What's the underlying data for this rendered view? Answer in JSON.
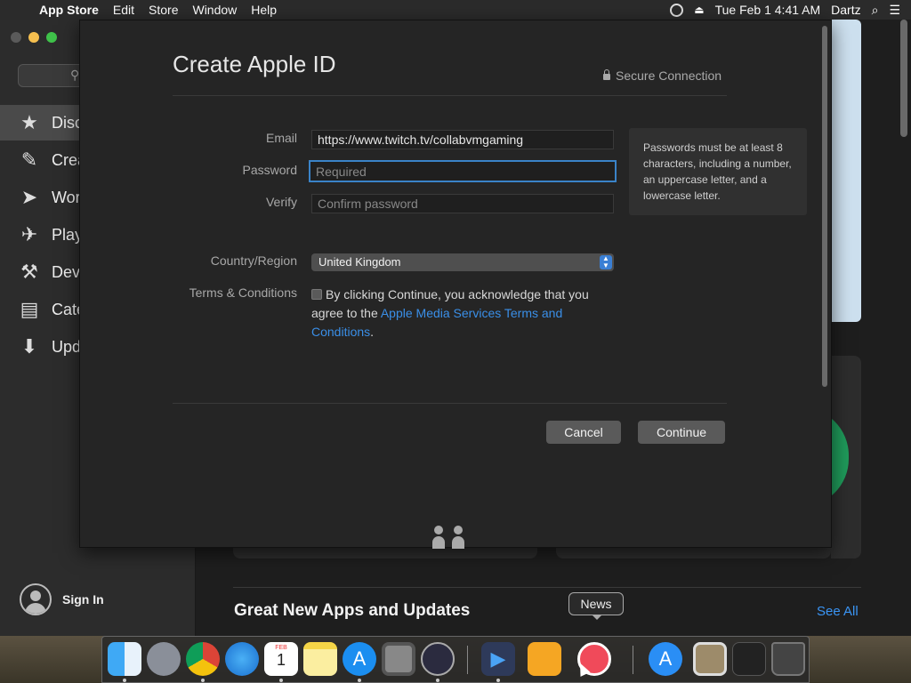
{
  "menubar": {
    "app_name": "App Store",
    "items": [
      "Edit",
      "Store",
      "Window",
      "Help"
    ],
    "clock": "Tue Feb 1  4:41 AM",
    "user": "Dartz"
  },
  "sidebar": {
    "items": [
      {
        "label": "Disc",
        "icon": "star-icon"
      },
      {
        "label": "Crea",
        "icon": "brush-icon"
      },
      {
        "label": "Wor",
        "icon": "paper-plane-icon"
      },
      {
        "label": "Play",
        "icon": "rocket-icon"
      },
      {
        "label": "Dev",
        "icon": "hammer-icon"
      },
      {
        "label": "Cate",
        "icon": "stack-icon"
      },
      {
        "label": "Upd",
        "icon": "download-icon"
      }
    ],
    "sign_in": "Sign In"
  },
  "main": {
    "section_title": "Great New Apps and Updates",
    "see_all": "See All"
  },
  "sheet": {
    "title": "Create Apple ID",
    "secure": "Secure Connection",
    "email_label": "Email",
    "email_value": "https://www.twitch.tv/collabvmgaming",
    "password_label": "Password",
    "password_placeholder": "Required",
    "verify_label": "Verify",
    "verify_placeholder": "Confirm password",
    "password_hint": "Passwords must be at least 8 characters, including a number, an uppercase letter, and a lowercase letter.",
    "country_label": "Country/Region",
    "country_value": "United Kingdom",
    "terms_label": "Terms & Conditions",
    "terms_text": "By clicking Continue, you acknowledge that you agree to the ",
    "terms_link": "Apple Media Services Terms and Conditions",
    "terms_end": ".",
    "cancel": "Cancel",
    "continue": "Continue"
  },
  "dock": {
    "tooltip": "News",
    "apps": [
      "finder-icon",
      "launchpad-icon",
      "chrome-icon",
      "safari-icon",
      "calendar-icon",
      "notes-icon",
      "app-store-icon",
      "system-preferences-icon",
      "obs-icon",
      "media-player-icon",
      "home-icon",
      "news-icon",
      "app-store-downloads-icon",
      "preview-icon",
      "screenshot-icon",
      "trash-icon"
    ],
    "calendar_month": "FEB",
    "calendar_day": "1"
  },
  "colors": {
    "accent": "#3a83c8",
    "link": "#3a8fe8",
    "see_all": "#3a95f5",
    "sheet_bg": "#252525"
  }
}
